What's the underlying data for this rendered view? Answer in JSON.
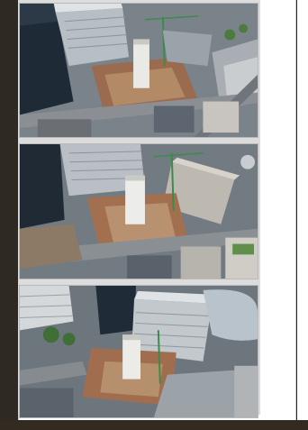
{
  "gallery": {
    "photos": [
      {
        "alt": ""
      },
      {
        "alt": ""
      },
      {
        "alt": ""
      }
    ]
  },
  "colors": {
    "background": "#2f2924",
    "panel": "#ffffff",
    "gallery_bg": "#dcdcdc",
    "photo_border": "#b9b9b9"
  }
}
